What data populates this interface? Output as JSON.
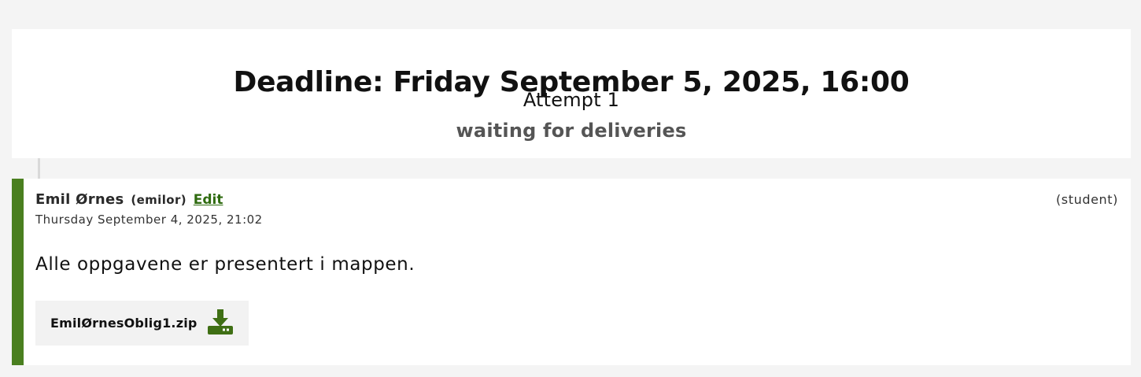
{
  "deadline": {
    "title": "Deadline: Friday September 5, 2025, 16:00",
    "attempt": "Attempt 1",
    "status": "waiting for deliveries"
  },
  "comment": {
    "author_name": "Emil Ørnes",
    "author_username": "(emilor)",
    "edit_label": "Edit",
    "role": "(student)",
    "timestamp": "Thursday September 4, 2025, 21:02",
    "text": "Alle oppgavene er presentert i mappen.",
    "attachment": {
      "filename": "EmilØrnesOblig1.zip",
      "icon": "download-icon"
    }
  },
  "colors": {
    "accent": "#4a7f1f",
    "link": "#2f6b10",
    "icon": "#3f6f14",
    "page_background": "#f4f4f4",
    "card_background": "#ffffff",
    "muted_text": "#555555"
  }
}
